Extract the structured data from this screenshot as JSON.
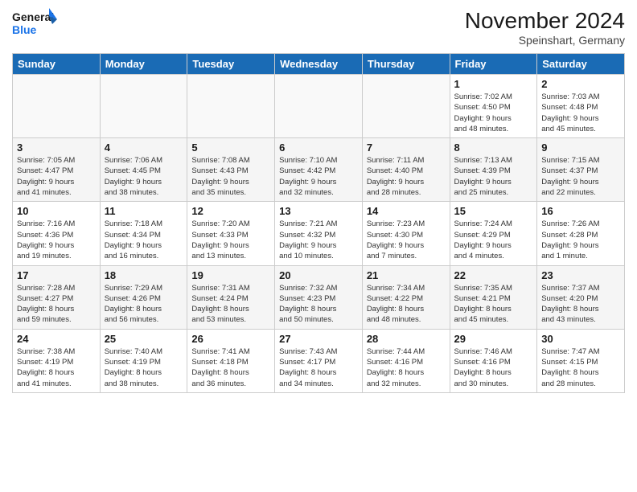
{
  "header": {
    "logo_line1": "General",
    "logo_line2": "Blue",
    "month_title": "November 2024",
    "location": "Speinshart, Germany"
  },
  "weekdays": [
    "Sunday",
    "Monday",
    "Tuesday",
    "Wednesday",
    "Thursday",
    "Friday",
    "Saturday"
  ],
  "weeks": [
    [
      {
        "day": "",
        "info": ""
      },
      {
        "day": "",
        "info": ""
      },
      {
        "day": "",
        "info": ""
      },
      {
        "day": "",
        "info": ""
      },
      {
        "day": "",
        "info": ""
      },
      {
        "day": "1",
        "info": "Sunrise: 7:02 AM\nSunset: 4:50 PM\nDaylight: 9 hours\nand 48 minutes."
      },
      {
        "day": "2",
        "info": "Sunrise: 7:03 AM\nSunset: 4:48 PM\nDaylight: 9 hours\nand 45 minutes."
      }
    ],
    [
      {
        "day": "3",
        "info": "Sunrise: 7:05 AM\nSunset: 4:47 PM\nDaylight: 9 hours\nand 41 minutes."
      },
      {
        "day": "4",
        "info": "Sunrise: 7:06 AM\nSunset: 4:45 PM\nDaylight: 9 hours\nand 38 minutes."
      },
      {
        "day": "5",
        "info": "Sunrise: 7:08 AM\nSunset: 4:43 PM\nDaylight: 9 hours\nand 35 minutes."
      },
      {
        "day": "6",
        "info": "Sunrise: 7:10 AM\nSunset: 4:42 PM\nDaylight: 9 hours\nand 32 minutes."
      },
      {
        "day": "7",
        "info": "Sunrise: 7:11 AM\nSunset: 4:40 PM\nDaylight: 9 hours\nand 28 minutes."
      },
      {
        "day": "8",
        "info": "Sunrise: 7:13 AM\nSunset: 4:39 PM\nDaylight: 9 hours\nand 25 minutes."
      },
      {
        "day": "9",
        "info": "Sunrise: 7:15 AM\nSunset: 4:37 PM\nDaylight: 9 hours\nand 22 minutes."
      }
    ],
    [
      {
        "day": "10",
        "info": "Sunrise: 7:16 AM\nSunset: 4:36 PM\nDaylight: 9 hours\nand 19 minutes."
      },
      {
        "day": "11",
        "info": "Sunrise: 7:18 AM\nSunset: 4:34 PM\nDaylight: 9 hours\nand 16 minutes."
      },
      {
        "day": "12",
        "info": "Sunrise: 7:20 AM\nSunset: 4:33 PM\nDaylight: 9 hours\nand 13 minutes."
      },
      {
        "day": "13",
        "info": "Sunrise: 7:21 AM\nSunset: 4:32 PM\nDaylight: 9 hours\nand 10 minutes."
      },
      {
        "day": "14",
        "info": "Sunrise: 7:23 AM\nSunset: 4:30 PM\nDaylight: 9 hours\nand 7 minutes."
      },
      {
        "day": "15",
        "info": "Sunrise: 7:24 AM\nSunset: 4:29 PM\nDaylight: 9 hours\nand 4 minutes."
      },
      {
        "day": "16",
        "info": "Sunrise: 7:26 AM\nSunset: 4:28 PM\nDaylight: 9 hours\nand 1 minute."
      }
    ],
    [
      {
        "day": "17",
        "info": "Sunrise: 7:28 AM\nSunset: 4:27 PM\nDaylight: 8 hours\nand 59 minutes."
      },
      {
        "day": "18",
        "info": "Sunrise: 7:29 AM\nSunset: 4:26 PM\nDaylight: 8 hours\nand 56 minutes."
      },
      {
        "day": "19",
        "info": "Sunrise: 7:31 AM\nSunset: 4:24 PM\nDaylight: 8 hours\nand 53 minutes."
      },
      {
        "day": "20",
        "info": "Sunrise: 7:32 AM\nSunset: 4:23 PM\nDaylight: 8 hours\nand 50 minutes."
      },
      {
        "day": "21",
        "info": "Sunrise: 7:34 AM\nSunset: 4:22 PM\nDaylight: 8 hours\nand 48 minutes."
      },
      {
        "day": "22",
        "info": "Sunrise: 7:35 AM\nSunset: 4:21 PM\nDaylight: 8 hours\nand 45 minutes."
      },
      {
        "day": "23",
        "info": "Sunrise: 7:37 AM\nSunset: 4:20 PM\nDaylight: 8 hours\nand 43 minutes."
      }
    ],
    [
      {
        "day": "24",
        "info": "Sunrise: 7:38 AM\nSunset: 4:19 PM\nDaylight: 8 hours\nand 41 minutes."
      },
      {
        "day": "25",
        "info": "Sunrise: 7:40 AM\nSunset: 4:19 PM\nDaylight: 8 hours\nand 38 minutes."
      },
      {
        "day": "26",
        "info": "Sunrise: 7:41 AM\nSunset: 4:18 PM\nDaylight: 8 hours\nand 36 minutes."
      },
      {
        "day": "27",
        "info": "Sunrise: 7:43 AM\nSunset: 4:17 PM\nDaylight: 8 hours\nand 34 minutes."
      },
      {
        "day": "28",
        "info": "Sunrise: 7:44 AM\nSunset: 4:16 PM\nDaylight: 8 hours\nand 32 minutes."
      },
      {
        "day": "29",
        "info": "Sunrise: 7:46 AM\nSunset: 4:16 PM\nDaylight: 8 hours\nand 30 minutes."
      },
      {
        "day": "30",
        "info": "Sunrise: 7:47 AM\nSunset: 4:15 PM\nDaylight: 8 hours\nand 28 minutes."
      }
    ]
  ]
}
